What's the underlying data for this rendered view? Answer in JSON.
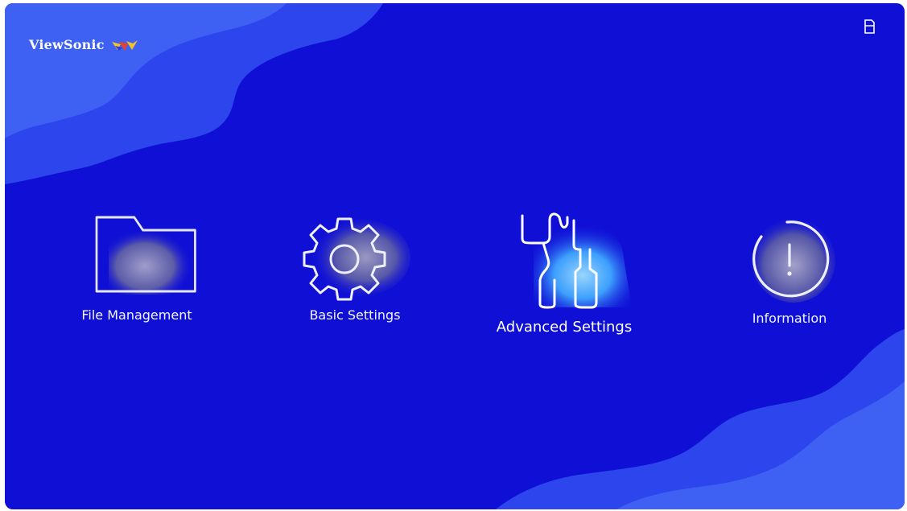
{
  "brand": {
    "name": "ViewSonic",
    "logo_icon": "viewsonic-birds-logo"
  },
  "status": {
    "storage_icon": "sd-card-icon"
  },
  "menu": {
    "selected": "Advanced Settings",
    "items": [
      {
        "label": "File Management",
        "icon": "folder-icon"
      },
      {
        "label": "Basic Settings",
        "icon": "gear-icon"
      },
      {
        "label": "Advanced Settings",
        "icon": "wrench-tools-icon"
      },
      {
        "label": "Information",
        "icon": "info-icon"
      }
    ]
  },
  "colors": {
    "background": "#0f0fd6",
    "wave": "#3d63f2",
    "highlight": "#3fa6ff",
    "logo_yellow": "#f3c12c",
    "logo_red": "#e5432a"
  }
}
